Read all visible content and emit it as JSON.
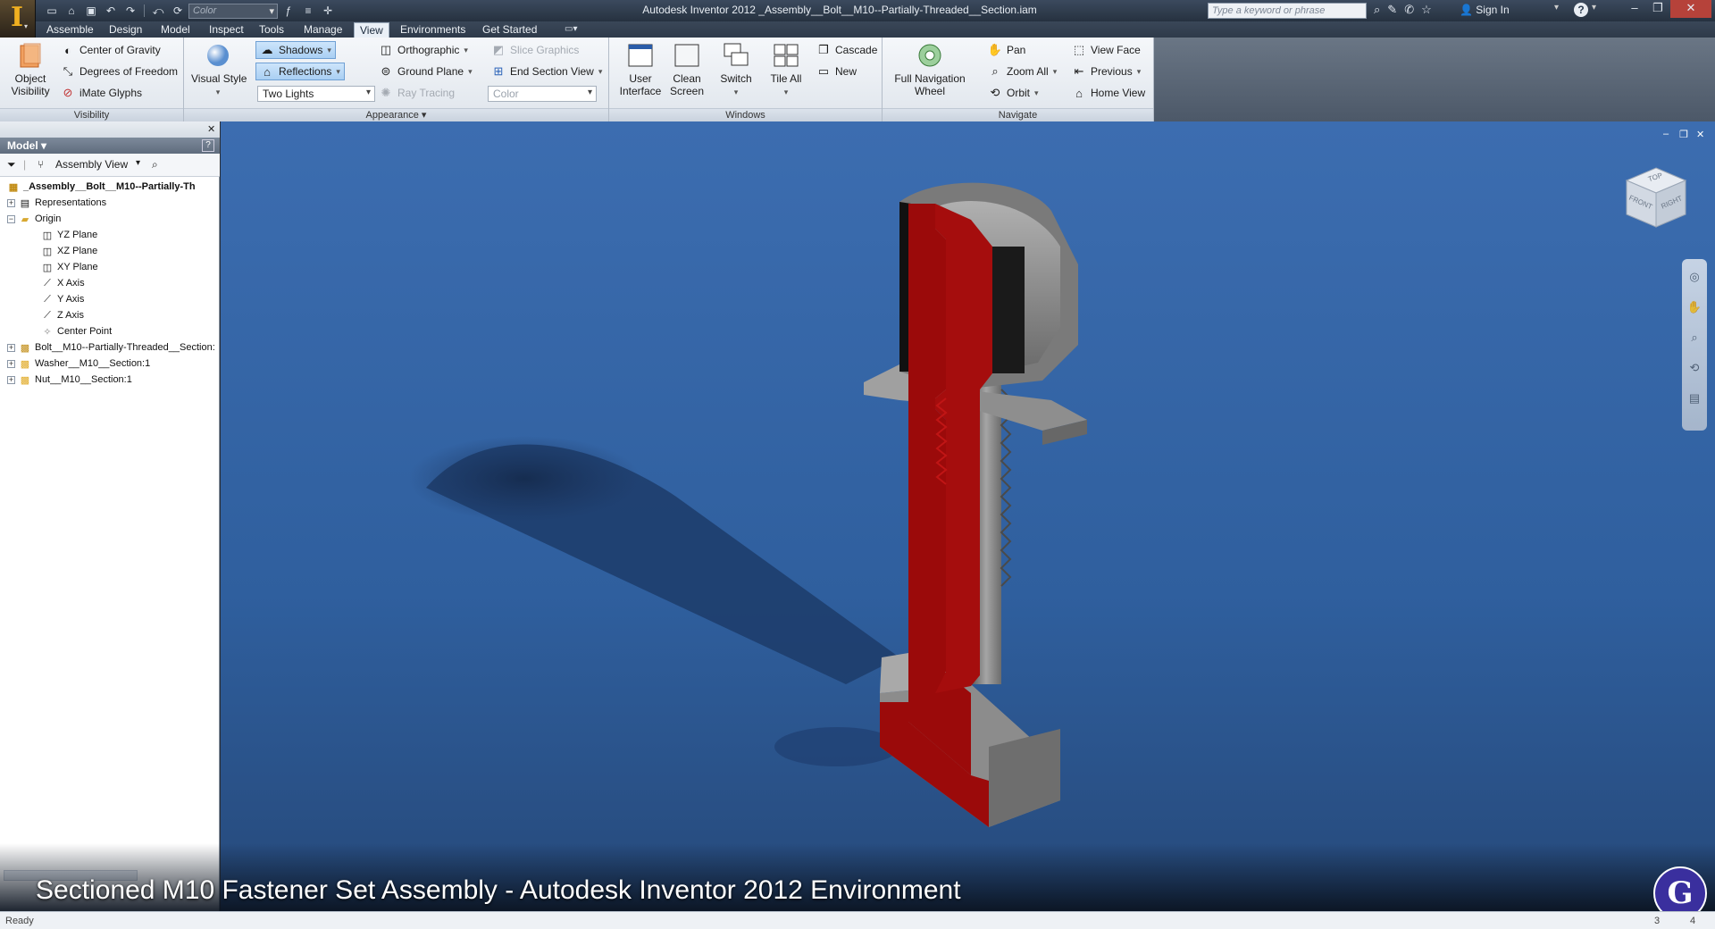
{
  "app": {
    "logo_letter": "I",
    "window_title": "Autodesk Inventor 2012    _Assembly__Bolt__M10--Partially-Threaded__Section.iam"
  },
  "qat": {
    "color_placeholder": "Color"
  },
  "search": {
    "placeholder": "Type a keyword or phrase"
  },
  "user": {
    "sign_in": "Sign In",
    "help": "?"
  },
  "tabs": [
    "Assemble",
    "Design",
    "Model",
    "Inspect",
    "Tools",
    "Manage",
    "View",
    "Environments",
    "Get Started"
  ],
  "active_tab": "View",
  "ribbon": {
    "visibility": {
      "title": "Visibility",
      "object_visibility": "Object Visibility",
      "center_of_gravity": "Center of Gravity",
      "degrees_of_freedom": "Degrees of Freedom",
      "imate_glyphs": "iMate Glyphs"
    },
    "appearance": {
      "title": "Appearance",
      "visual_style": "Visual Style",
      "shadows": "Shadows",
      "reflections": "Reflections",
      "lighting": "Two Lights",
      "orthographic": "Orthographic",
      "ground_plane": "Ground Plane",
      "ray_tracing": "Ray Tracing",
      "slice_graphics": "Slice Graphics",
      "end_section_view": "End Section View",
      "color": "Color"
    },
    "windows": {
      "title": "Windows",
      "user_interface": "User Interface",
      "clean_screen": "Clean Screen",
      "switch": "Switch",
      "tile_all": "Tile All",
      "cascade": "Cascade",
      "new": "New"
    },
    "navigate": {
      "title": "Navigate",
      "full_navigation_wheel": "Full Navigation Wheel",
      "pan": "Pan",
      "zoom_all": "Zoom All",
      "orbit": "Orbit",
      "view_face": "View Face",
      "previous": "Previous",
      "home_view": "Home View"
    }
  },
  "browser": {
    "header": "Model",
    "view_mode": "Assembly View",
    "tree": [
      {
        "label": "_Assembly__Bolt__M10--Partially-Th",
        "icon": "assembly-icon"
      },
      {
        "label": "Representations",
        "icon": "representations-icon"
      },
      {
        "label": "Origin",
        "icon": "folder-icon"
      },
      {
        "label": "YZ Plane",
        "icon": "plane-icon"
      },
      {
        "label": "XZ Plane",
        "icon": "plane-icon"
      },
      {
        "label": "XY Plane",
        "icon": "plane-icon"
      },
      {
        "label": "X Axis",
        "icon": "axis-icon"
      },
      {
        "label": "Y Axis",
        "icon": "axis-icon"
      },
      {
        "label": "Z Axis",
        "icon": "axis-icon"
      },
      {
        "label": "Center Point",
        "icon": "point-icon"
      },
      {
        "label": "Bolt__M10--Partially-Threaded__Section:",
        "icon": "part-icon"
      },
      {
        "label": "Washer__M10__Section:1",
        "icon": "part-icon"
      },
      {
        "label": "Nut__M10__Section:1",
        "icon": "part-icon"
      }
    ]
  },
  "viewcube": {
    "top": "TOP",
    "front": "FRONT",
    "right": "RIGHT"
  },
  "caption": "Sectioned M10 Fastener Set Assembly - Autodesk Inventor 2012 Environment",
  "brand_glyph": "G",
  "status": {
    "text": "Ready",
    "count_a": "3",
    "count_b": "4"
  },
  "colors": {
    "section_fill": "#9b0a0a",
    "viewport_bg": "#2f5f9e",
    "metal": "#8a8a8a"
  }
}
